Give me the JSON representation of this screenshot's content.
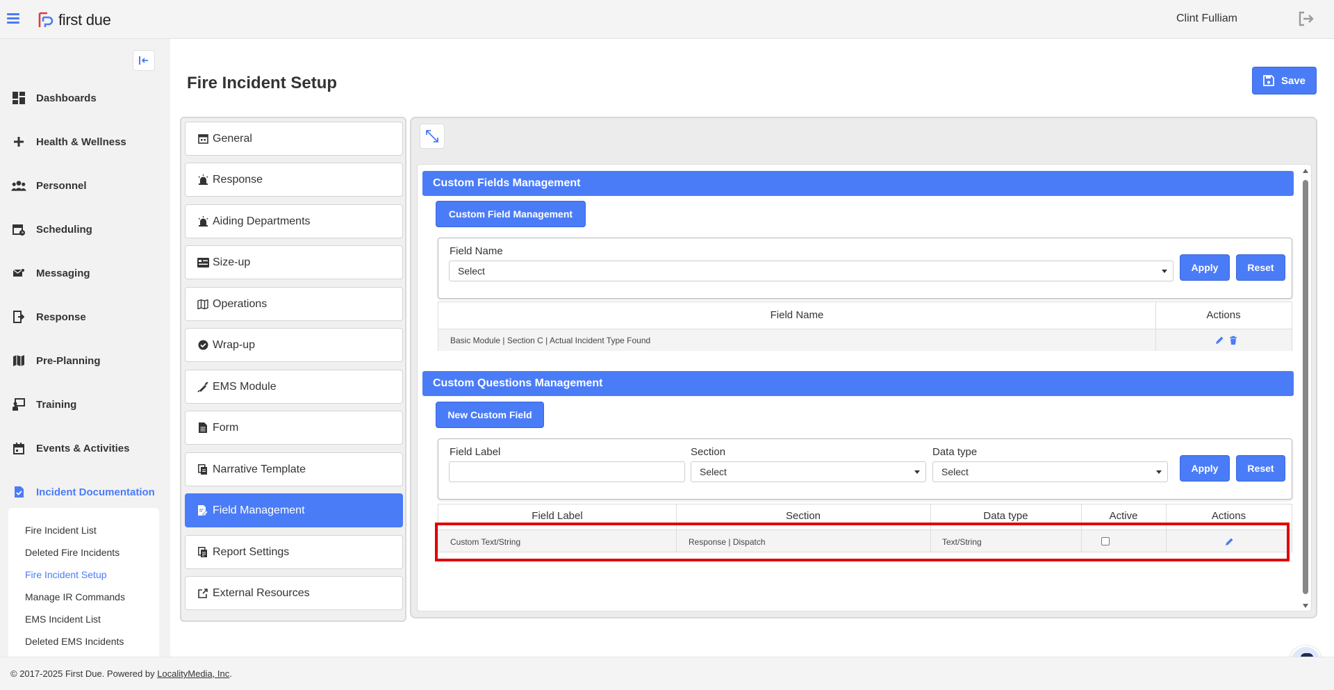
{
  "header": {
    "logo_text": "first due",
    "user_name": "Clint Fulliam"
  },
  "sidebar": {
    "items": [
      {
        "label": "Dashboards",
        "icon": "dashboard-icon"
      },
      {
        "label": "Health & Wellness",
        "icon": "plus-icon"
      },
      {
        "label": "Personnel",
        "icon": "people-icon"
      },
      {
        "label": "Scheduling",
        "icon": "calendar-clock-icon"
      },
      {
        "label": "Messaging",
        "icon": "mail-icon"
      },
      {
        "label": "Response",
        "icon": "door-exit-icon"
      },
      {
        "label": "Pre-Planning",
        "icon": "map-icon"
      },
      {
        "label": "Training",
        "icon": "training-icon"
      },
      {
        "label": "Events & Activities",
        "icon": "calendar-icon"
      },
      {
        "label": "Incident Documentation",
        "icon": "document-check-icon"
      }
    ],
    "subitems": [
      {
        "label": "Fire Incident List"
      },
      {
        "label": "Deleted Fire Incidents"
      },
      {
        "label": "Fire Incident Setup"
      },
      {
        "label": "Manage IR Commands"
      },
      {
        "label": "EMS Incident List"
      },
      {
        "label": "Deleted EMS Incidents"
      }
    ]
  },
  "page": {
    "title": "Fire Incident Setup",
    "save_label": "Save"
  },
  "setup_menu": [
    {
      "label": "General"
    },
    {
      "label": "Response"
    },
    {
      "label": "Aiding Departments"
    },
    {
      "label": "Size-up"
    },
    {
      "label": "Operations"
    },
    {
      "label": "Wrap-up"
    },
    {
      "label": "EMS Module"
    },
    {
      "label": "Form"
    },
    {
      "label": "Narrative Template"
    },
    {
      "label": "Field Management"
    },
    {
      "label": "Report Settings"
    },
    {
      "label": "External Resources"
    }
  ],
  "custom_fields": {
    "header": "Custom Fields Management",
    "button_label": "Custom Field Management",
    "filter_label": "Field Name",
    "filter_value": "Select",
    "apply_label": "Apply",
    "reset_label": "Reset",
    "columns": [
      "Field Name",
      "Actions"
    ],
    "rows": [
      {
        "field_name": "Basic Module | Section C | Actual Incident Type Found"
      }
    ]
  },
  "custom_questions": {
    "header": "Custom Questions Management",
    "button_label": "New Custom Field",
    "field_label_label": "Field Label",
    "field_label_value": "",
    "section_label": "Section",
    "section_value": "Select",
    "data_type_label": "Data type",
    "data_type_value": "Select",
    "apply_label": "Apply",
    "reset_label": "Reset",
    "columns": [
      "Field Label",
      "Section",
      "Data type",
      "Active",
      "Actions"
    ],
    "rows": [
      {
        "field_label": "Custom Text/String",
        "section": "Response | Dispatch",
        "data_type": "Text/String",
        "active": false
      }
    ]
  },
  "footer": {
    "text": "© 2017-2025 First Due. Powered by ",
    "link": "LocalityMedia, Inc",
    "suffix": "."
  },
  "colors": {
    "accent": "#4a7cf7",
    "highlight": "#e00000"
  }
}
